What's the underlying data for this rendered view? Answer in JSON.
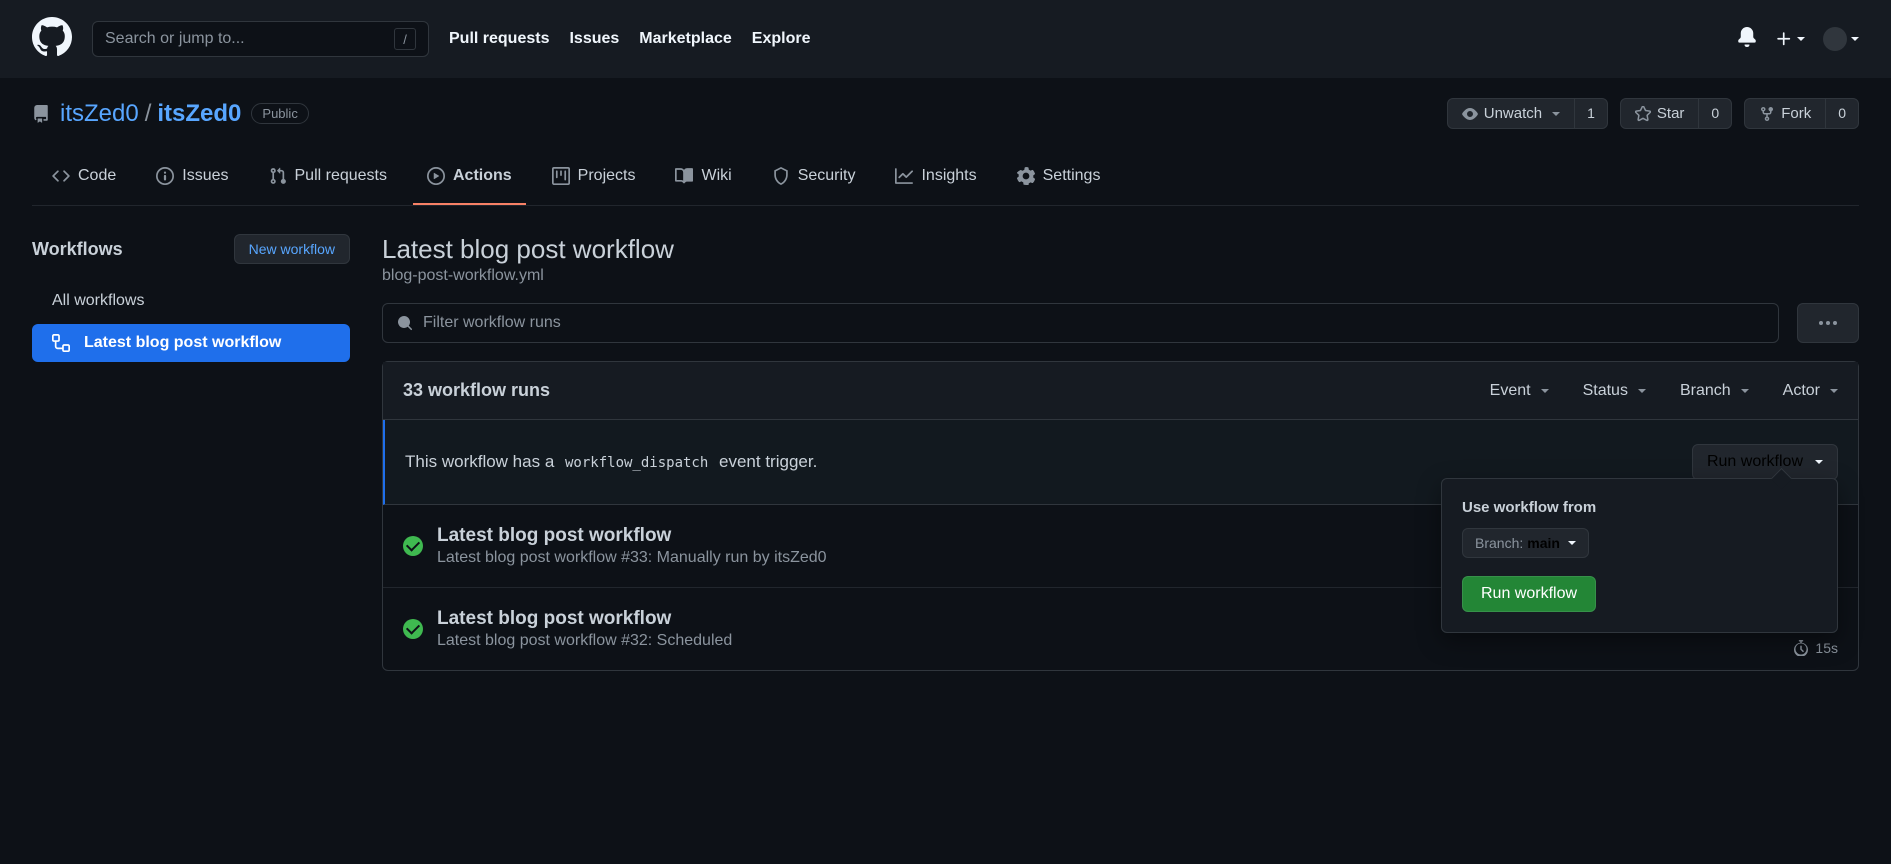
{
  "header": {
    "search_placeholder": "Search or jump to...",
    "slash": "/",
    "nav": [
      "Pull requests",
      "Issues",
      "Marketplace",
      "Explore"
    ]
  },
  "repo": {
    "owner": "itsZed0",
    "name": "itsZed0",
    "visibility": "Public",
    "actions": {
      "unwatch": "Unwatch",
      "unwatch_count": "1",
      "star": "Star",
      "star_count": "0",
      "fork": "Fork",
      "fork_count": "0"
    },
    "tabs": [
      "Code",
      "Issues",
      "Pull requests",
      "Actions",
      "Projects",
      "Wiki",
      "Security",
      "Insights",
      "Settings"
    ]
  },
  "sidebar": {
    "heading": "Workflows",
    "new_btn": "New workflow",
    "items": [
      {
        "label": "All workflows"
      },
      {
        "label": "Latest blog post workflow"
      }
    ]
  },
  "page": {
    "title": "Latest blog post workflow",
    "subtitle": "blog-post-workflow.yml",
    "filter_placeholder": "Filter workflow runs"
  },
  "runs": {
    "count_label": "33 workflow runs",
    "filters": [
      "Event",
      "Status",
      "Branch",
      "Actor"
    ],
    "dispatch_pre": "This workflow has a ",
    "dispatch_code": "workflow_dispatch",
    "dispatch_post": " event trigger.",
    "run_dd": "Run workflow",
    "popup": {
      "heading": "Use workflow from",
      "branch_label": "Branch:",
      "branch_value": "main",
      "run_btn": "Run workflow"
    },
    "items": [
      {
        "title": "Latest blog post workflow",
        "meta": "Latest blog post workflow #33: Manually run by itsZed0",
        "timing": ""
      },
      {
        "title": "Latest blog post workflow",
        "meta": "Latest blog post workflow #32: Scheduled",
        "timing": "15s"
      }
    ]
  }
}
